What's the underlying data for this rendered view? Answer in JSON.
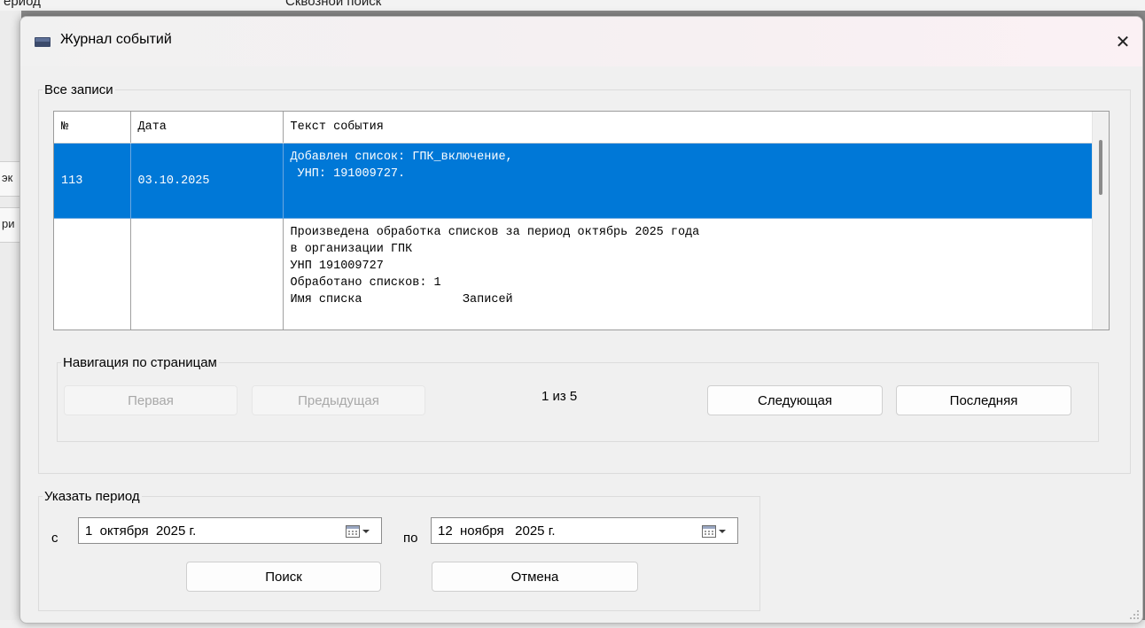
{
  "background": {
    "left_fragment": "ериод",
    "search_fragment": "Сквозной поиск",
    "side_fragments": [
      "эк",
      "ри"
    ]
  },
  "window": {
    "title": "Журнал событий",
    "close_symbol": "✕"
  },
  "records": {
    "group_label": "Все записи",
    "columns": [
      "№",
      "Дата",
      "Текст события"
    ],
    "rows": [
      {
        "number": "113",
        "date": "03.10.2025",
        "text": "Добавлен список: ГПК_включение,\n УНП: 191009727.",
        "selected": true
      },
      {
        "number": "",
        "date": "",
        "text": "Произведена обработка списков за период октябрь 2025 года\nв организации ГПК\nУНП 191009727\nОбработано списков: 1\nИмя списка              Записей",
        "selected": false
      }
    ]
  },
  "navigation": {
    "group_label": "Навигация по страницам",
    "first_label": "Первая",
    "prev_label": "Предыдущая",
    "page_info": "1 из 5",
    "next_label": "Следующая",
    "last_label": "Последняя"
  },
  "period": {
    "group_label": "Указать период",
    "from_label": "с",
    "from_value": "1  октября  2025 г.",
    "to_label": "по",
    "to_value": "12  ноября   2025 г.",
    "search_label": "Поиск",
    "cancel_label": "Отмена"
  },
  "colors": {
    "selection": "#0078d7",
    "dialog_bg": "#f0f0f0"
  }
}
